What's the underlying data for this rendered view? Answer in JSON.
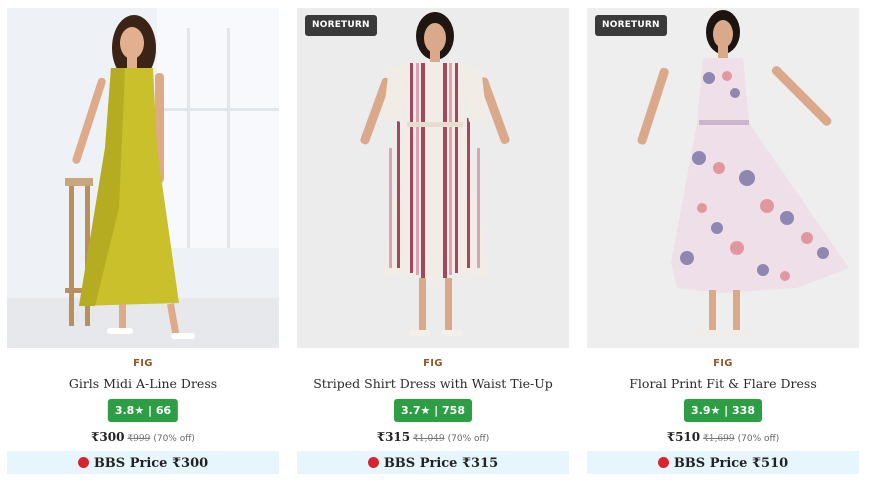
{
  "products": [
    {
      "badge": "",
      "brand": "FIG",
      "name": "Girls Midi A-Line Dress",
      "rating": "3.8★ | 66",
      "price": "₹300",
      "mrp": "₹999",
      "discount": "(70% off)",
      "bbs_label": "BBS Price ₹300",
      "image_icon": "yellow-dress-photo",
      "dress_color": "#c9c02c"
    },
    {
      "badge": "NORETURN",
      "brand": "FIG",
      "name": "Striped Shirt Dress with Waist Tie-Up",
      "rating": "3.7★ | 758",
      "price": "₹315",
      "mrp": "₹1,049",
      "discount": "(70% off)",
      "bbs_label": "BBS Price ₹315",
      "image_icon": "striped-dress-photo",
      "dress_color": "#f1ece5"
    },
    {
      "badge": "NORETURN",
      "brand": "FIG",
      "name": "Floral Print Fit & Flare Dress",
      "rating": "3.9★ | 338",
      "price": "₹510",
      "mrp": "₹1,699",
      "discount": "(70% off)",
      "bbs_label": "BBS Price ₹510",
      "image_icon": "floral-dress-photo",
      "dress_color": "#efdfe8"
    }
  ],
  "colors": {
    "brand_text": "#8a5a2b",
    "rating_bg": "#2e9e44",
    "bbs_bg": "#e7f6fd",
    "badge_bg": "#3a3a3a"
  }
}
